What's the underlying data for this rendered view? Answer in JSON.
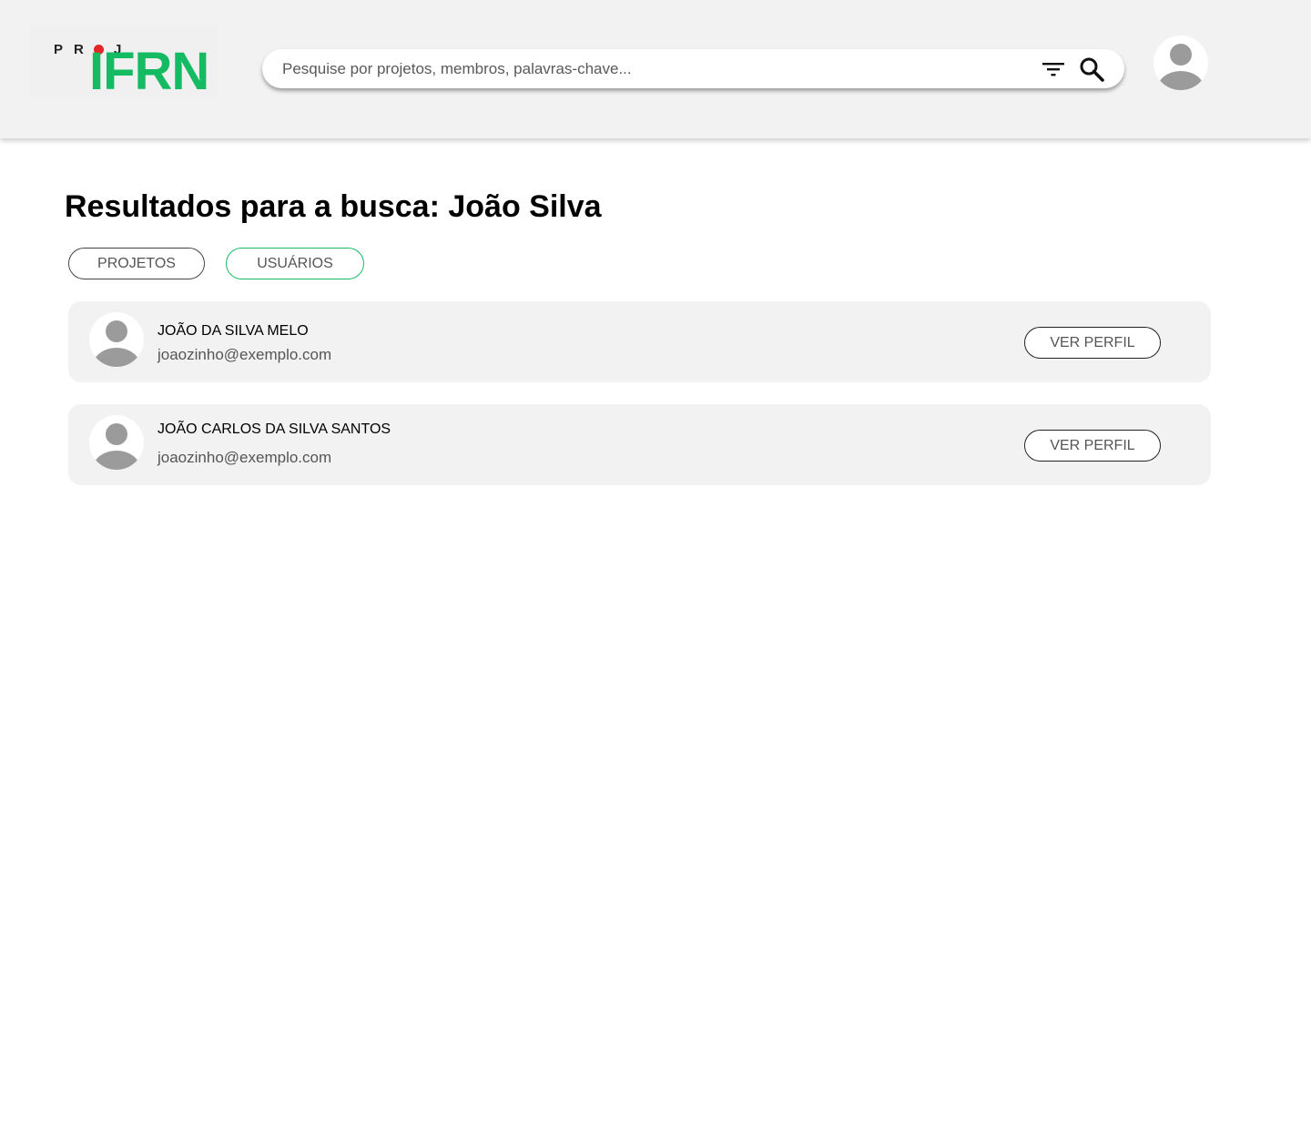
{
  "header": {
    "logo": {
      "proj_letters": [
        "P",
        "R",
        "J"
      ],
      "brand": "IFRN",
      "colors": {
        "brand": "#14bb63",
        "dot": "#e32626"
      }
    },
    "search": {
      "placeholder": "Pesquise por projetos, membros, palavras-chave...",
      "value": "",
      "filter_icon": "filter-icon",
      "search_icon": "search-icon"
    },
    "user_avatar_icon": "user-avatar-icon"
  },
  "main": {
    "title": "Resultados para a busca: João Silva",
    "tabs": [
      {
        "label": "PROJETOS",
        "active": false
      },
      {
        "label": "USUÁRIOS",
        "active": true
      }
    ],
    "results": [
      {
        "name": "JOÃO DA SILVA MELO",
        "email": "joaozinho@exemplo.com",
        "button": "VER PERFIL"
      },
      {
        "name": "JOÃO CARLOS DA SILVA SANTOS",
        "email": "joaozinho@exemplo.com",
        "button": "VER PERFIL"
      }
    ]
  },
  "colors": {
    "header_bg": "#f2f2f2",
    "card_bg": "#f2f2f2",
    "accent": "#14bb63",
    "avatar_gray": "#9b9b9b"
  }
}
